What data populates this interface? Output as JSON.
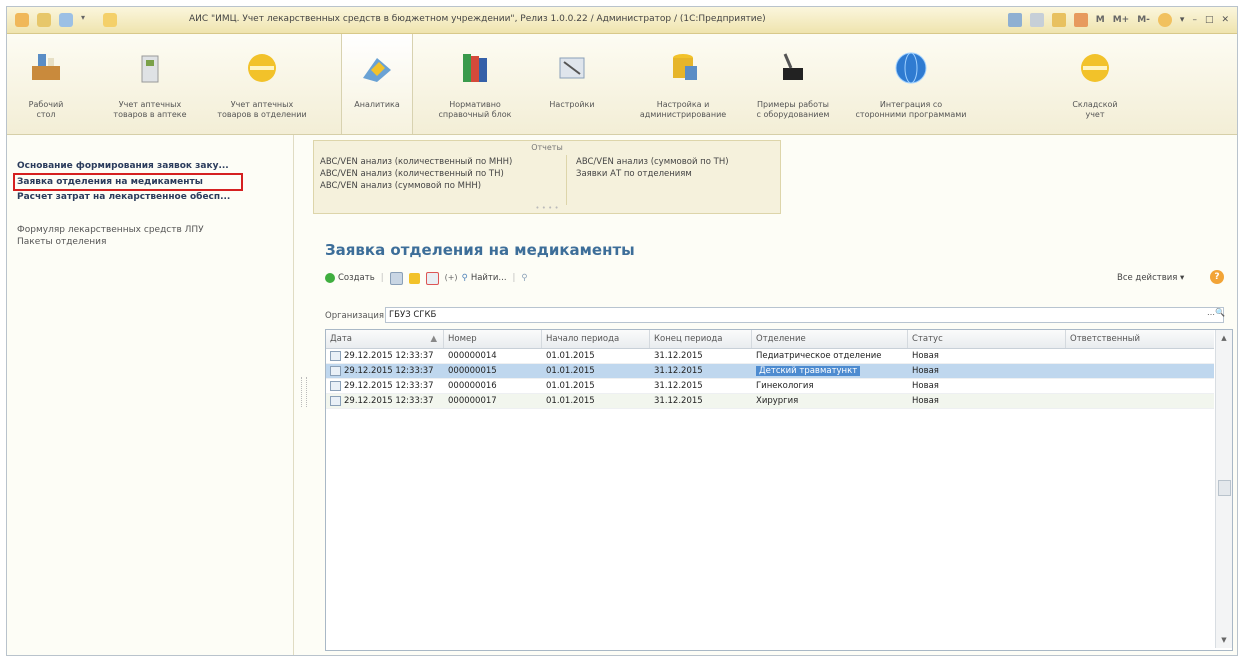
{
  "window": {
    "title": "АИС \"ИМЦ. Учет лекарственных средств в бюджетном учреждении\", Релиз 1.0.0.22 / Администратор / (1С:Предприятие)",
    "mem_buttons": [
      "M",
      "M+",
      "M-"
    ]
  },
  "sections": [
    {
      "label1": "Рабочий",
      "label2": "стол",
      "icon": "desktop-icon"
    },
    {
      "label1": "Учет аптечных",
      "label2": "товаров в аптеке",
      "icon": "pharmacy-icon"
    },
    {
      "label1": "Учет аптечных",
      "label2": "товаров в отделении",
      "icon": "coin-icon"
    },
    {
      "label1": "Аналитика",
      "label2": "",
      "icon": "analytics-icon"
    },
    {
      "label1": "Нормативно",
      "label2": "справочный блок",
      "icon": "books-icon"
    },
    {
      "label1": "Настройки",
      "label2": "",
      "icon": "settings-icon"
    },
    {
      "label1": "Настройка и",
      "label2": "администрирование",
      "icon": "database-icon"
    },
    {
      "label1": "Примеры работы",
      "label2": "с оборудованием",
      "icon": "scanner-icon"
    },
    {
      "label1": "Интеграция со",
      "label2": "сторонними программами",
      "icon": "globe-icon"
    },
    {
      "label1": "Складской",
      "label2": "учет",
      "icon": "coin-icon"
    }
  ],
  "left_panel": {
    "bold_items": [
      "Основание формирования заявок заку...",
      "Заявка отделения на медикаменты",
      "Расчет затрат на лекарственное обесп..."
    ],
    "items": [
      "Формуляр лекарственных средств ЛПУ",
      "Пакеты отделения"
    ]
  },
  "reports": {
    "title": "Отчеты",
    "col1": [
      "ABC/VEN анализ (количественный по МНН)",
      "ABC/VEN анализ (количественный по ТН)",
      "ABC/VEN анализ (суммовой по МНН)"
    ],
    "col2": [
      "ABC/VEN анализ (суммовой по ТН)",
      "Заявки АТ по отделениям"
    ]
  },
  "form": {
    "title": "Заявка отделения на медикаменты",
    "create_label": "Создать",
    "find_label": "Найти...",
    "all_actions": "Все действия ▾",
    "org_label": "Организация:",
    "org_value": "ГБУЗ СГКБ"
  },
  "table": {
    "columns": [
      "Дата",
      "Номер",
      "Начало периода",
      "Конец периода",
      "Отделение",
      "Статус",
      "Ответственный"
    ],
    "rows": [
      {
        "date": "29.12.2015 12:33:37",
        "number": "000000014",
        "start": "01.01.2015",
        "end": "31.12.2015",
        "dept": "Педиатрическое отделение",
        "status": "Новая",
        "resp": ""
      },
      {
        "date": "29.12.2015 12:33:37",
        "number": "000000015",
        "start": "01.01.2015",
        "end": "31.12.2015",
        "dept": "Детский травматункт",
        "status": "Новая",
        "resp": ""
      },
      {
        "date": "29.12.2015 12:33:37",
        "number": "000000016",
        "start": "01.01.2015",
        "end": "31.12.2015",
        "dept": "Гинекология",
        "status": "Новая",
        "resp": ""
      },
      {
        "date": "29.12.2015 12:33:37",
        "number": "000000017",
        "start": "01.01.2015",
        "end": "31.12.2015",
        "dept": "Хирургия",
        "status": "Новая",
        "resp": ""
      }
    ],
    "selected_row": 1
  }
}
